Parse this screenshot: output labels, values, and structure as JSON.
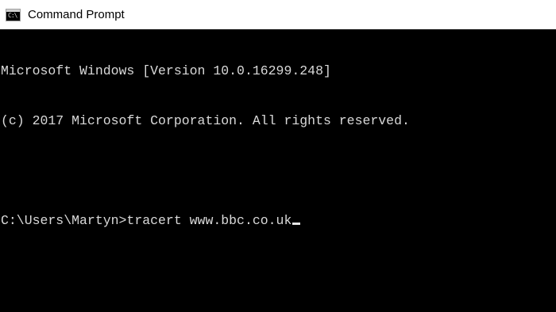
{
  "window": {
    "title": "Command Prompt",
    "icon": "cmd-icon",
    "icon_glyph": "C:\\"
  },
  "console": {
    "lines": [
      "Microsoft Windows [Version 10.0.16299.248]",
      "(c) 2017 Microsoft Corporation. All rights reserved.",
      "",
      "C:\\Users\\Martyn>tracert www.bbc.co.uk"
    ]
  },
  "colors": {
    "console_background": "#000000",
    "console_text": "#d9d9d9",
    "titlebar_background": "#ffffff"
  }
}
